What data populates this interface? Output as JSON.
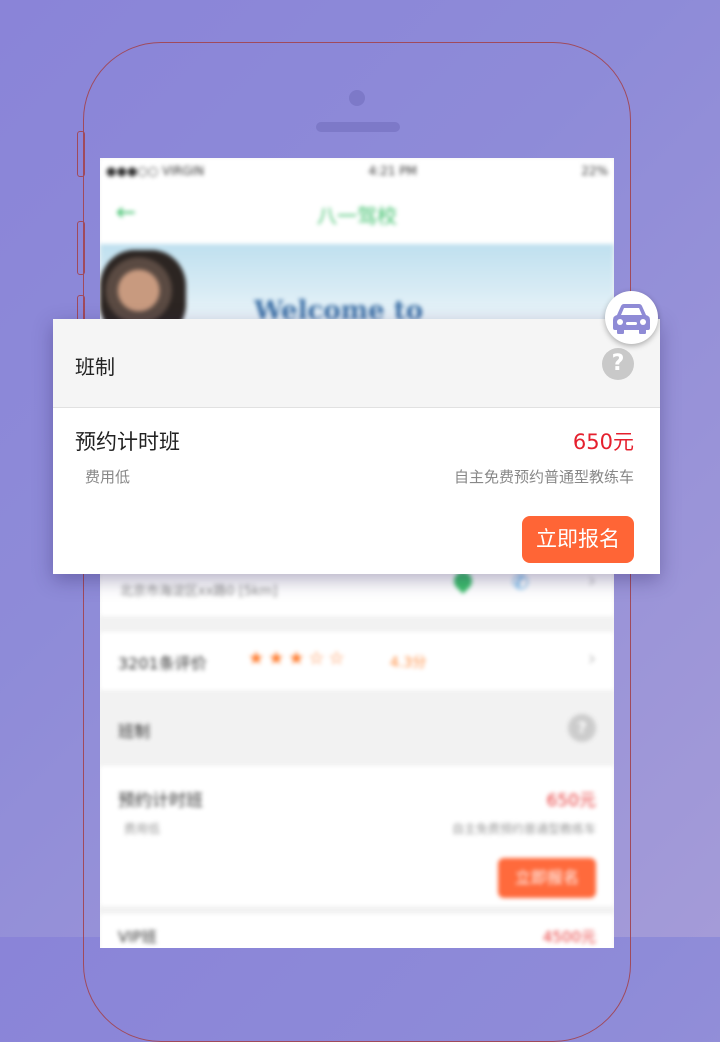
{
  "status_bar": {
    "carrier": "●●●○○ VIRGIN",
    "time": "4:21 PM",
    "battery": "22%"
  },
  "nav": {
    "title": "八一驾校"
  },
  "banner": {
    "welcome_text": "Welcome to"
  },
  "school": {
    "address": "北京市海淀区xx路0 [5km]"
  },
  "reviews": {
    "count_label": "3201条评价",
    "stars": "★★★☆☆",
    "score": "4.3分"
  },
  "popup": {
    "section_title": "班制",
    "help_symbol": "?",
    "class": {
      "name": "预约计时班",
      "price": "650元",
      "tag": "费用低",
      "description": "自主免费预约普通型教练车",
      "enroll_label": "立即报名"
    }
  },
  "background_list": {
    "section_title": "班制",
    "class": {
      "name": "预约计时班",
      "price": "650元",
      "tag": "费用低",
      "description": "自主免费预约普通型教练车",
      "enroll_label": "立即报名"
    },
    "next_item": {
      "name": "VIP班",
      "price": "4500元"
    }
  },
  "colors": {
    "accent_green": "#3cbf6a",
    "price_red": "#e5202e",
    "button_orange": "#ff6536",
    "backdrop_purple": "#8a84d8"
  },
  "icons": {
    "badge": "car-icon",
    "help": "question-icon",
    "back": "back-arrow-icon"
  }
}
